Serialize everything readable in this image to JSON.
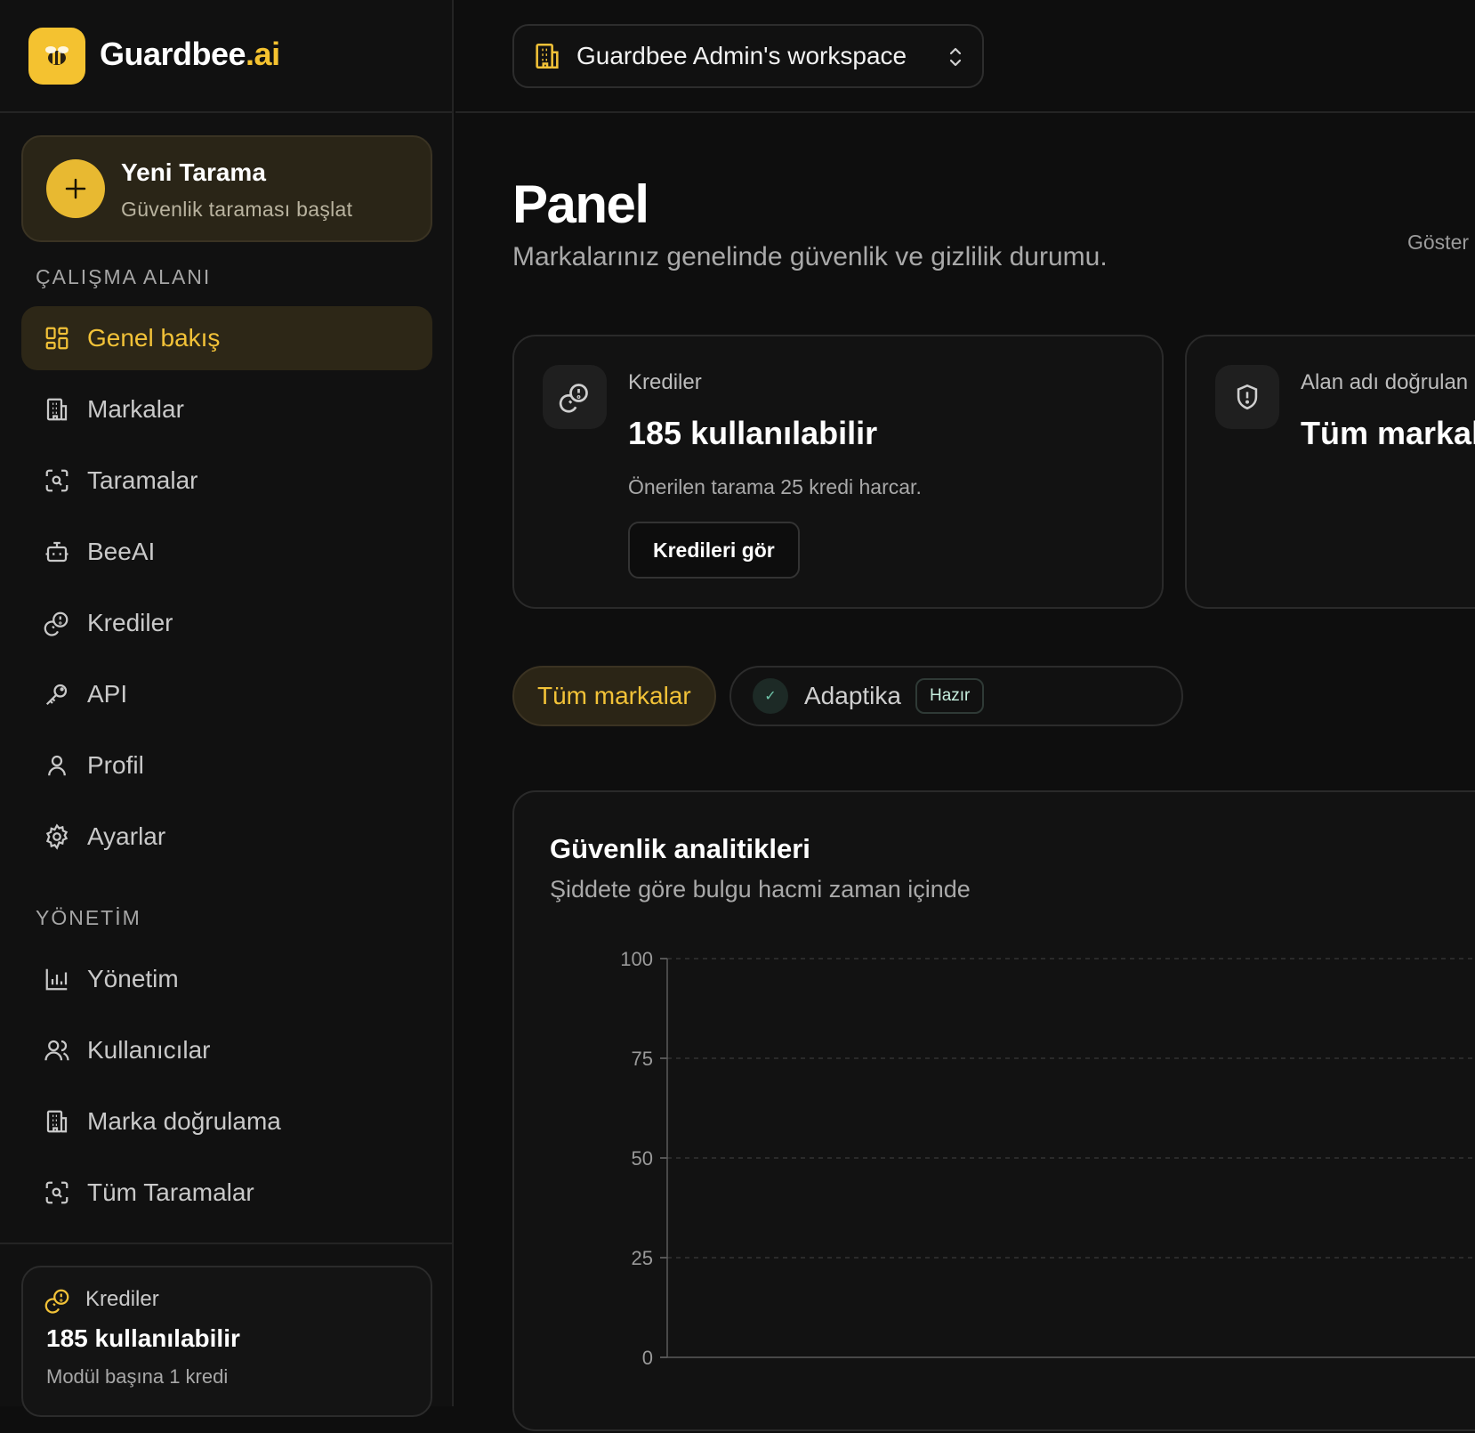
{
  "brand": {
    "name": "Guardbee",
    "suffix": ".ai"
  },
  "new_scan": {
    "title": "Yeni Tarama",
    "subtitle": "Güvenlik taraması başlat"
  },
  "sidebar": {
    "workspace_section": "ÇALIŞMA ALANI",
    "workspace_items": [
      {
        "label": "Genel bakış",
        "icon": "grid-icon",
        "active": true
      },
      {
        "label": "Markalar",
        "icon": "building-icon"
      },
      {
        "label": "Taramalar",
        "icon": "scan-icon"
      },
      {
        "label": "BeeAI",
        "icon": "bot-icon"
      },
      {
        "label": "Krediler",
        "icon": "coins-icon"
      },
      {
        "label": "API",
        "icon": "key-icon"
      },
      {
        "label": "Profil",
        "icon": "user-icon"
      },
      {
        "label": "Ayarlar",
        "icon": "gear-icon"
      }
    ],
    "admin_section": "YÖNETİM",
    "admin_items": [
      {
        "label": "Yönetim",
        "icon": "bar-chart-icon"
      },
      {
        "label": "Kullanıcılar",
        "icon": "users-icon"
      },
      {
        "label": "Marka doğrulama",
        "icon": "building-icon"
      },
      {
        "label": "Tüm Taramalar",
        "icon": "scan-icon"
      }
    ],
    "credits": {
      "label": "Krediler",
      "value": "185 kullanılabilir",
      "sub": "Modül başına 1 kredi"
    }
  },
  "topbar": {
    "workspace": "Guardbee Admin's workspace"
  },
  "main": {
    "title": "Panel",
    "subtitle": "Markalarınız genelinde güvenlik ve gizlilik durumu.",
    "cut_text": "Göster",
    "cards": [
      {
        "label": "Krediler",
        "value": "185 kullanılabilir",
        "desc": "Önerilen tarama 25 kredi harcar.",
        "button": "Kredileri gör"
      },
      {
        "label": "Alan adı doğrulan",
        "value": "Tüm markal"
      }
    ],
    "filters": {
      "all": "Tüm markalar",
      "brand": "Adaptika",
      "badge": "Hazır"
    },
    "analytics": {
      "title": "Güvenlik analitikleri",
      "subtitle": "Şiddete göre bulgu hacmi zaman içinde"
    }
  },
  "colors": {
    "accent": "#f2c238",
    "background": "#0e0e0e",
    "panel": "#121212"
  },
  "chart_data": {
    "type": "line",
    "yticks": [
      100,
      75,
      50,
      25,
      0
    ],
    "ylim": [
      0,
      100
    ],
    "grid": true,
    "series": []
  }
}
